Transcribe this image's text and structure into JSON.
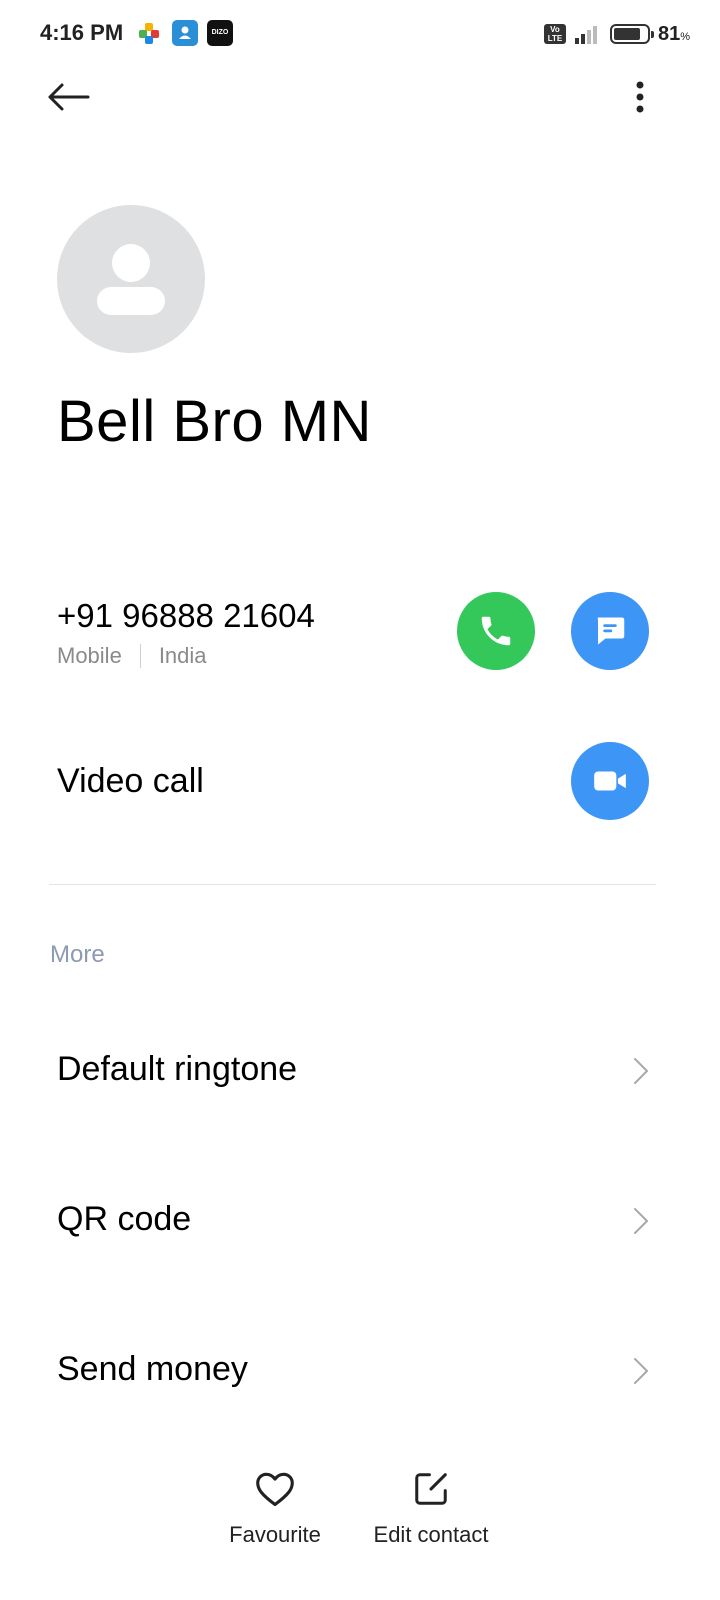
{
  "status_bar": {
    "time": "4:16 PM",
    "notification_icons": [
      "puzzle-app-icon",
      "contacts-app-icon",
      "dizo-app-icon"
    ],
    "dizo_label": "DIZO",
    "network_label": "Vo LTE",
    "battery_percent": "81",
    "battery_unit": "%"
  },
  "header": {
    "back_icon": "back-arrow-icon",
    "menu_icon": "more-vert-icon"
  },
  "contact": {
    "name": "Bell Bro MN",
    "phone": "+91 96888 21604",
    "phone_type": "Mobile",
    "phone_region": "India"
  },
  "actions": {
    "call_icon": "phone-icon",
    "message_icon": "message-icon",
    "video_call_label": "Video call",
    "video_icon": "video-camera-icon"
  },
  "more_section": {
    "title": "More",
    "items": [
      {
        "label": "Default ringtone"
      },
      {
        "label": "QR code"
      },
      {
        "label": "Send money"
      }
    ]
  },
  "bottom_bar": {
    "favourite_label": "Favourite",
    "edit_label": "Edit contact"
  },
  "colors": {
    "call_green": "#34c85a",
    "action_blue": "#3d95f5",
    "section_label": "#8e99b3"
  }
}
